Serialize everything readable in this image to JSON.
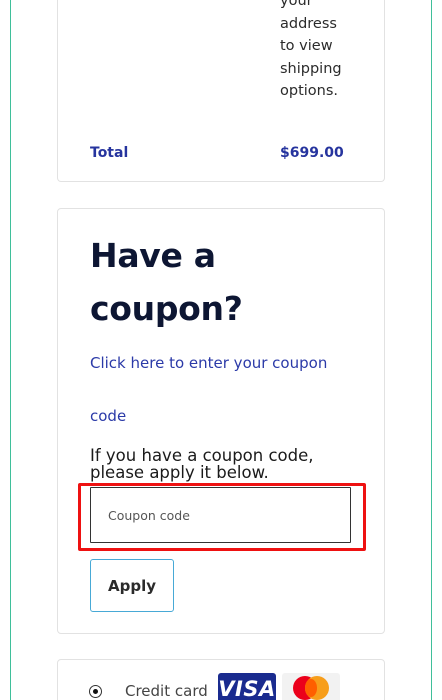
{
  "order_summary": {
    "shipping_note_lines": [
      "your",
      "address",
      "to view",
      "shipping",
      "options."
    ],
    "total_label": "Total",
    "total_value": "$699.00"
  },
  "coupon": {
    "title_lines": [
      "Have a",
      "coupon?"
    ],
    "link_text_line1": "Click here to enter your coupon",
    "link_text_line2": "code",
    "hint_line1": "If you have a coupon code,",
    "hint_line2": "please apply it below.",
    "input_placeholder": "Coupon code",
    "input_value": "",
    "apply_label": "Apply"
  },
  "payment": {
    "method_label": "Credit card",
    "selected": true,
    "card_logos": [
      "VISA",
      "mastercard-icon"
    ]
  },
  "colors": {
    "accent_blue": "#26349e",
    "link_blue": "#2b3aa8",
    "highlight_red": "#ee1111",
    "button_border": "#47a9d6",
    "frame_teal": "#3fbf9a"
  }
}
